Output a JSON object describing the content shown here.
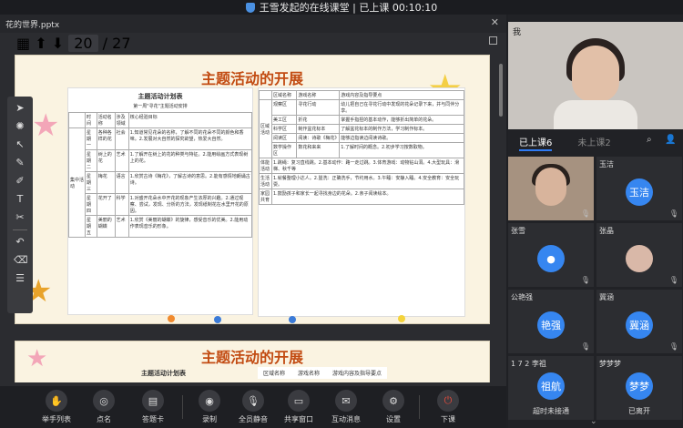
{
  "window": {
    "title": "王雪发起的在线课堂 | 已上课 00:10:10"
  },
  "viewer": {
    "filename": "花的世界.pptx",
    "page_current": "20",
    "page_total": "/ 27"
  },
  "slides": [
    {
      "title": "主题活动的开展",
      "plan_title": "主题活动计划表",
      "plan_subtitle": "第一周\"寻花\"主题活动安排",
      "plan_headers": [
        "时间",
        "活动名称",
        "涉及领域",
        "核心经验目标"
      ],
      "plan_section": "集中活动",
      "plan_rows": [
        [
          "星期一",
          "各种各样的花",
          "社会",
          "1.知道常见花朵的名称，了解不同的花朵不同的颜色和香味。2.发展对大自然的探究欲望，热爱大自然。"
        ],
        [
          "星期二",
          "树上的花",
          "艺术",
          "1.了解开在树上的花的种类与特征。2.能用绘画方式表现树上的花。"
        ],
        [
          "星期三",
          "梅花",
          "语言",
          "1.欣赏古诗《梅花》，了解古诗的意思。2.能有感情地朗诵古诗。"
        ],
        [
          "星期四",
          "花开了",
          "科学",
          "1.对盛开花朵水中开花的现象产生浓厚的兴趣。2.通过观察、尝试，发现、分析的方法，发现纸制花在水里开花的原因。"
        ],
        [
          "星期五",
          "美丽的蝴蝶",
          "艺术",
          "1.欣赏《美丽的蝴蝶》的旋律，感受音乐的优美。2.能用动作表现音乐的形象。"
        ]
      ],
      "area_headers": [
        "区域名称",
        "游戏名称",
        "游戏内容及指导要点"
      ],
      "area_section": "区域活动",
      "area_rows": [
        [
          "观察区",
          "寻花行动",
          "幼儿把自己在寻花行动中发现的花朵记录下来，并与同伴分享。"
        ],
        [
          "美工区",
          "折花",
          "掌握手指捏的基本动作，能够折出简单的花朵。"
        ],
        [
          "科学区",
          "制作盆花标本",
          "了解盆花标本的制作方法，学习制作标本。"
        ],
        [
          "阅读区",
          "阅读：诗歌《梅花》",
          "能够边指读边阅读诗歌。"
        ],
        [
          "数学操作区",
          "数花和来来",
          "1.了解时间的概念。2.初步学习按数取物。"
        ]
      ],
      "other_rows": [
        [
          "体能活动",
          "1.跳绳：复习直线跳。2.基本动作：路一走过跳。3.体育游戏：动物钻山洞。4.大型玩具：滑梯、秋千等"
        ],
        [
          "生活活动",
          "1.就餐整理小达人。2.盥洗：正确洗手，节约用水。3.午睡：安静入睡。4.安全教育：安全玩耍。"
        ],
        [
          "家园共育",
          "1.鼓励孩子和家长一起寻找身边的花朵。2.亲子阅读绘本。"
        ]
      ]
    },
    {
      "title": "主题活动的开展",
      "plan_title": "主题活动计划表",
      "area_headers": [
        "区域名称",
        "游戏名称",
        "游戏内容及指导要点"
      ]
    }
  ],
  "toolbox": {
    "tools": [
      "cursor-icon",
      "laser-icon",
      "select-icon",
      "pen-icon",
      "highlighter-icon",
      "text-icon",
      "cut-icon",
      "undo-icon",
      "eraser-icon",
      "stack-icon"
    ]
  },
  "bottombar": {
    "items": [
      {
        "label": "举手列表",
        "icon": "hand-icon"
      },
      {
        "label": "点名",
        "icon": "rollcall-icon"
      },
      {
        "label": "答题卡",
        "icon": "answer-card-icon"
      },
      {
        "label": "录制",
        "icon": "record-icon"
      },
      {
        "label": "全员静音",
        "icon": "mute-all-icon"
      },
      {
        "label": "共享窗口",
        "icon": "share-window-icon"
      },
      {
        "label": "互动消息",
        "icon": "message-icon"
      },
      {
        "label": "设置",
        "icon": "settings-icon"
      },
      {
        "label": "下课",
        "icon": "end-class-icon"
      }
    ]
  },
  "teacher": {
    "label": "我"
  },
  "participants": {
    "tab_on": "已上课6",
    "tab_off": "未上课2",
    "list": [
      {
        "name": "",
        "avatar": "",
        "kind": "video"
      },
      {
        "name": "玉洁",
        "avatar": "玉洁",
        "kind": "avatar"
      },
      {
        "name": "张雪",
        "avatar": "",
        "kind": "person"
      },
      {
        "name": "张晶",
        "avatar": "",
        "kind": "photo"
      },
      {
        "name": "公艳强",
        "avatar": "艳强",
        "kind": "avatar"
      },
      {
        "name": "冀涵",
        "avatar": "冀涵",
        "kind": "avatar"
      },
      {
        "name": "1 7 2 李祖",
        "avatar": "祖航",
        "kind": "avatar",
        "status": "超时未接通"
      },
      {
        "name": "梦梦梦",
        "avatar": "梦梦",
        "kind": "avatar",
        "status": "已离开"
      }
    ]
  },
  "colors": {
    "accent": "#2f7bf5",
    "avatar": "#3686f0",
    "slide_title": "#c24b12",
    "end_button": "#e84b3c"
  }
}
